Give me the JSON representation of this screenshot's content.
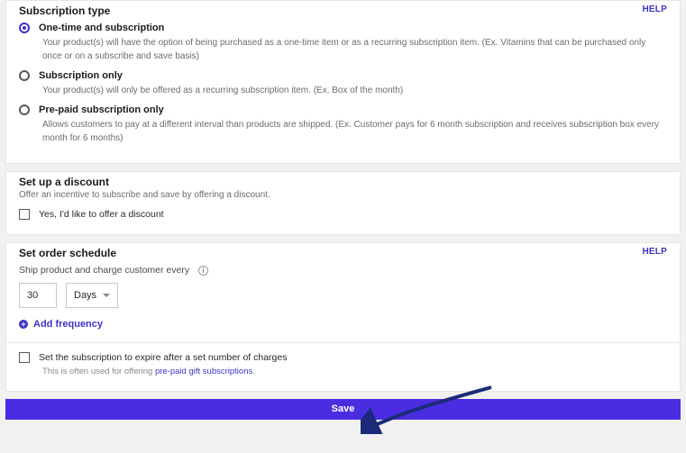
{
  "subscriptionType": {
    "title": "Subscription type",
    "help": "HELP",
    "options": [
      {
        "label": "One-time and subscription",
        "desc": "Your product(s) will have the option of being purchased as a one-time item or as a recurring subscription item. (Ex. Vitamins that can be purchased only once or on a subscribe and save basis)",
        "selected": true
      },
      {
        "label": "Subscription only",
        "desc": "Your product(s) will only be offered as a recurring subscription item. (Ex. Box of the month)",
        "selected": false
      },
      {
        "label": "Pre-paid subscription only",
        "desc": "Allows customers to pay at a different interval than products are shipped. (Ex. Customer pays for 6 month subscription and receives subscription box every month for 6 months)",
        "selected": false
      }
    ]
  },
  "discount": {
    "title": "Set up a discount",
    "desc": "Offer an incentive to subscribe and save by offering a discount.",
    "checkboxLabel": "Yes, I'd like to offer a discount"
  },
  "schedule": {
    "title": "Set order schedule",
    "help": "HELP",
    "scheduleLabel": "Ship product and charge customer every",
    "intervalValue": "30",
    "intervalUnit": "Days",
    "addFrequency": "Add frequency",
    "expireLabel": "Set the subscription to expire after a set number of charges",
    "expireDescPrefix": "This is often used for offering ",
    "expireDescLink": "pre-paid gift subscriptions",
    "expireDescSuffix": "."
  },
  "saveLabel": "Save"
}
